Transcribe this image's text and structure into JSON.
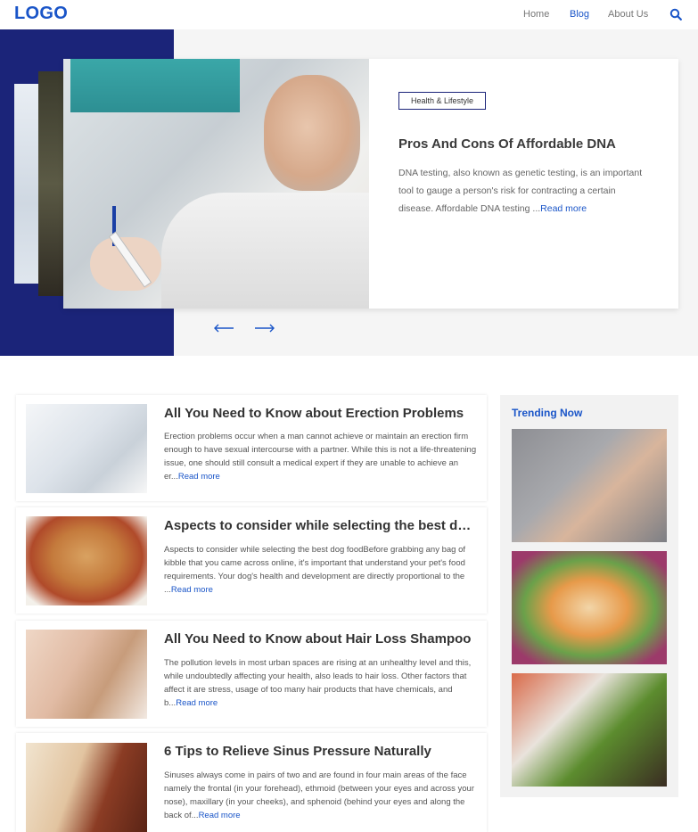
{
  "header": {
    "logo": "LOGO",
    "nav": [
      "Home",
      "Blog",
      "About Us"
    ],
    "active": "Blog"
  },
  "hero": {
    "badge": "Health & Lifestyle",
    "title": "Pros And Cons Of Affordable DNA",
    "description": "DNA testing, also known as genetic testing, is an important tool to gauge a person's risk for contracting a certain disease. Affordable DNA testing ...",
    "read_more": "Read more"
  },
  "articles": [
    {
      "title": "All You Need to Know about Erection Problems",
      "description": "Erection problems occur when a man cannot achieve or maintain an erection firm enough to have sexual intercourse with a partner. While this is not a life-threatening issue, one should still consult a medical expert if they are unable to achieve an er...",
      "read_more": "Read more"
    },
    {
      "title": "Aspects to consider while selecting the best dog food",
      "description": "Aspects to consider while selecting the best dog foodBefore grabbing any bag of kibble that you came across online, it's important that understand your pet's food requirements. Your dog's health and development are directly proportional to the ...",
      "read_more": "Read more"
    },
    {
      "title": "All You Need to Know about Hair Loss Shampoo",
      "description": "The pollution levels in most urban spaces are rising at an unhealthy level and this, while undoubtedly affecting your health, also leads to hair loss. Other factors that affect it are stress, usage of too many hair products that have chemicals, and b...",
      "read_more": "Read more"
    },
    {
      "title": "6 Tips to Relieve Sinus Pressure Naturally",
      "description": "Sinuses always come in pairs of two and are found in four main areas of the face namely the frontal (in your forehead), ethmoid (between your eyes and across your nose), maxillary (in your cheeks), and sphenoid (behind your eyes and along the back of...",
      "read_more": "Read more"
    }
  ],
  "sidebar": {
    "title": "Trending Now"
  },
  "colors": {
    "brand": "#1a55c8",
    "hero_navy": "#1b2479"
  }
}
